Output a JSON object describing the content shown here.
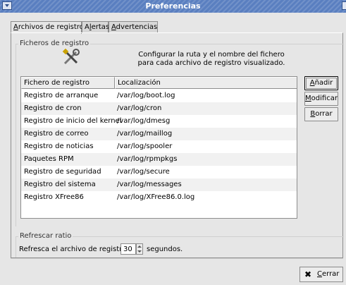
{
  "window": {
    "title": "Preferencias"
  },
  "tabs": [
    {
      "label_pre": "",
      "label_mn": "A",
      "label_post": "rchivos de registro"
    },
    {
      "label_pre": "A",
      "label_mn": "l",
      "label_post": "ertas"
    },
    {
      "label_pre": "",
      "label_mn": "A",
      "label_post": "dvertencias"
    }
  ],
  "log_files": {
    "group_label": "Ficheros de registro",
    "hint_line1": "Configurar la ruta y el nombre del fichero",
    "hint_line2": "para cada archivo de registro visualizado.",
    "columns": [
      "Fichero de registro",
      "Localización"
    ],
    "rows": [
      {
        "name": "Registro de arranque",
        "location": "/var/log/boot.log"
      },
      {
        "name": "Registro de cron",
        "location": "/var/log/cron"
      },
      {
        "name": "Registro de inicio del kernel",
        "location": "/var/log/dmesg"
      },
      {
        "name": "Registro de correo",
        "location": "/var/log/maillog"
      },
      {
        "name": "Registro de noticias",
        "location": "/var/log/spooler"
      },
      {
        "name": "Paquetes RPM",
        "location": "/var/log/rpmpkgs"
      },
      {
        "name": "Registro de seguridad",
        "location": "/var/log/secure"
      },
      {
        "name": "Registro del sistema",
        "location": "/var/log/messages"
      },
      {
        "name": "Registro XFree86",
        "location": "/var/log/XFree86.0.log"
      }
    ],
    "buttons": {
      "add_mn": "A",
      "add_rest": "ñadir",
      "modify_mn": "M",
      "modify_rest": "odificar",
      "delete_mn": "B",
      "delete_rest": "orrar"
    }
  },
  "refresh": {
    "group_label": "Refrescar ratio",
    "label": "Refresca el archivo de registro",
    "value": "30",
    "unit": "segundos."
  },
  "footer": {
    "close_mn": "C",
    "close_rest": "errar"
  },
  "icons": {
    "menu": "window-menu-icon",
    "tools": "tools-icon",
    "close": "close-x-icon"
  }
}
